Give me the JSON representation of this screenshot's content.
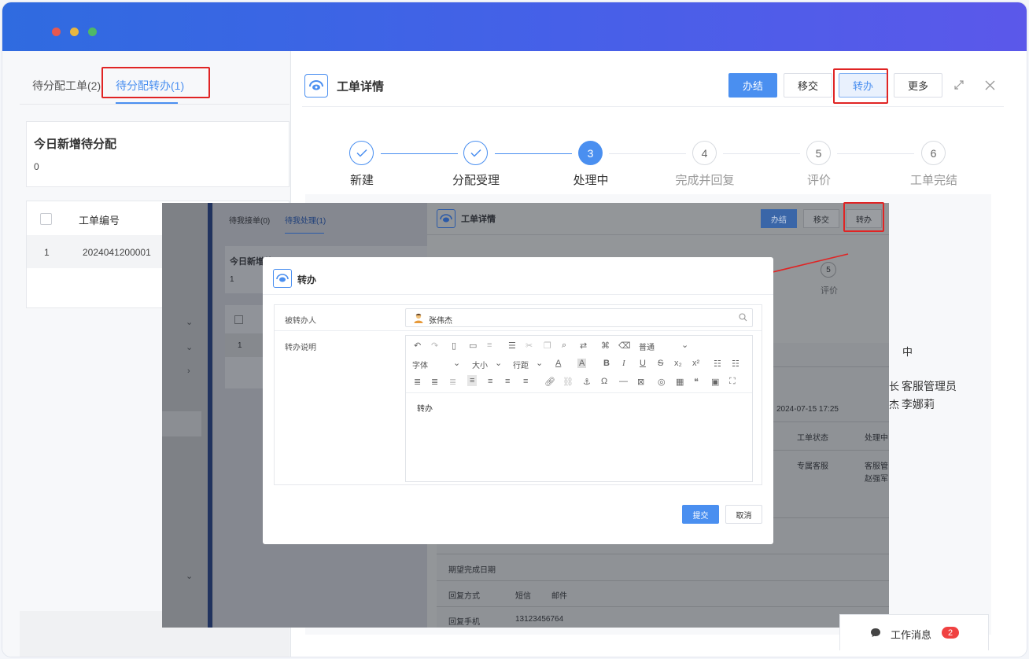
{
  "left": {
    "tabs": [
      {
        "label": "待分配工单(2)"
      },
      {
        "label": "待分配转办(1)"
      }
    ],
    "card_title": "今日新增待分配",
    "card_count": "0",
    "table": {
      "header": "工单编号",
      "rows": [
        {
          "index": "1",
          "id": "2024041200001"
        }
      ]
    }
  },
  "detail": {
    "title": "工单详情",
    "buttons": {
      "finish": "办结",
      "transfer_over": "移交",
      "forward": "转办",
      "more": "更多"
    },
    "steps": [
      {
        "num": "",
        "label": "新建",
        "state": "done"
      },
      {
        "num": "",
        "label": "分配受理",
        "state": "done"
      },
      {
        "num": "3",
        "label": "处理中",
        "state": "current"
      },
      {
        "num": "4",
        "label": "完成并回复",
        "state": "todo"
      },
      {
        "num": "5",
        "label": "评价",
        "state": "todo"
      },
      {
        "num": "6",
        "label": "工单完结",
        "state": "todo"
      }
    ],
    "peek": {
      "status_suffix": "中",
      "role_a_suffix": "长",
      "role_a": "客服管理员",
      "role_b_suffix": "杰",
      "role_b": "李娜莉"
    }
  },
  "inner": {
    "tabs": [
      "待我接单(0)",
      "待我处理(1)"
    ],
    "card_title": "今日新增待",
    "card_count": "1",
    "row_index": "1",
    "detail_title": "工单详情",
    "buttons": {
      "finish": "办结",
      "transfer_over": "移交",
      "forward": "转办"
    },
    "step_num": "5",
    "step_label": "评价",
    "time": "2024-07-15 17:25",
    "status_label": "工单状态",
    "status_value": "处理中",
    "cs_label": "专属客服",
    "cs_value_1": "客服管",
    "cs_value_2": "赵强军",
    "expected_date_label": "期望完成日期",
    "reply_method_label": "回复方式",
    "reply_sms": "短信",
    "reply_email": "邮件",
    "reply_phone_label": "回复手机",
    "reply_phone": "13123456764"
  },
  "dialog": {
    "title": "转办",
    "assignee_label": "被转办人",
    "assignee_name": "张伟杰",
    "note_label": "转办说明",
    "toolbar": {
      "paragraph": "普通",
      "font": "字体",
      "size": "大小",
      "line_height": "行距"
    },
    "editor_content": "转办",
    "submit": "提交",
    "cancel": "取消"
  },
  "messages": {
    "label": "工作消息",
    "count": "2"
  },
  "colors": {
    "primary": "#4a8ff0",
    "highlight": "#e02424",
    "titlebar": "#3b67e4"
  }
}
